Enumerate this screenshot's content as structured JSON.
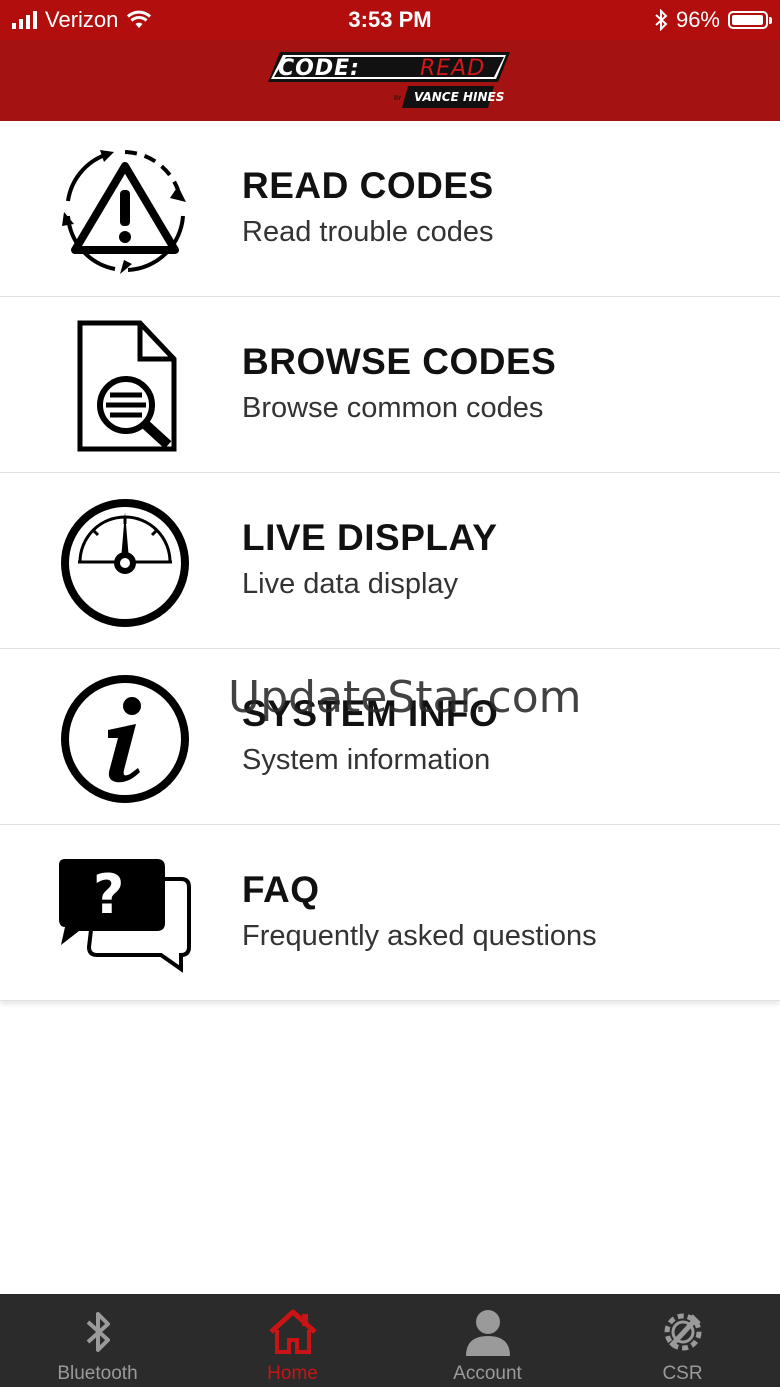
{
  "status_bar": {
    "carrier": "Verizon",
    "time": "3:53 PM",
    "battery_percent": "96%",
    "battery_level": 0.96
  },
  "header": {
    "logo_text": "CODE:READ",
    "logo_sub": "BY VANCE & HINES"
  },
  "menu": [
    {
      "title": "READ CODES",
      "subtitle": "Read trouble codes",
      "icon": "warning-cycle-icon"
    },
    {
      "title": "BROWSE CODES",
      "subtitle": "Browse common codes",
      "icon": "document-search-icon"
    },
    {
      "title": "LIVE DISPLAY",
      "subtitle": "Live data display",
      "icon": "gauge-icon"
    },
    {
      "title": "SYSTEM INFO",
      "subtitle": "System information",
      "icon": "info-icon"
    },
    {
      "title": "FAQ",
      "subtitle": "Frequently asked questions",
      "icon": "question-chat-icon"
    }
  ],
  "watermark": "UpdateStar.com",
  "tab_bar": {
    "tabs": [
      {
        "label": "Bluetooth",
        "icon": "bluetooth-icon",
        "active": false
      },
      {
        "label": "Home",
        "icon": "home-icon",
        "active": true
      },
      {
        "label": "Account",
        "icon": "person-icon",
        "active": false
      },
      {
        "label": "CSR",
        "icon": "gear-wrench-icon",
        "active": false
      }
    ]
  },
  "colors": {
    "status_bar": "#b20e0e",
    "header": "#a51212",
    "tab_bar": "#2b2b2b",
    "tab_active": "#c81414",
    "tab_inactive": "#9a9a9a"
  }
}
